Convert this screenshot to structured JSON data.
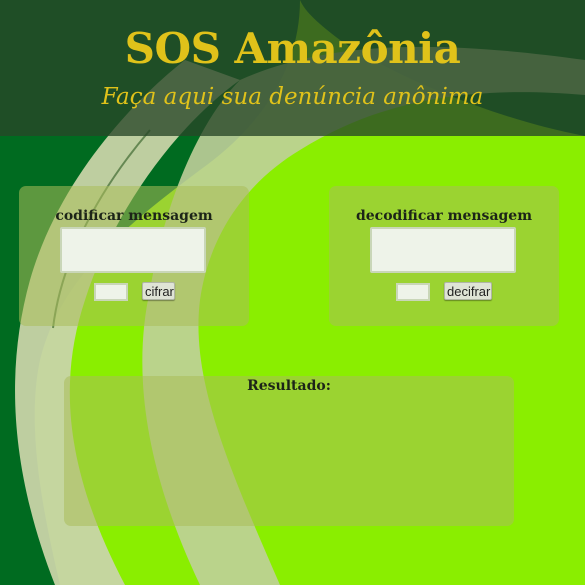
{
  "header": {
    "title": "SOS Amazônia",
    "subtitle": "Faça aqui sua denúncia anônima"
  },
  "encode": {
    "label": "codificar mensagem",
    "message_value": "",
    "key_value": "",
    "button_label": "cifrar"
  },
  "decode": {
    "label": "decodificar mensagem",
    "message_value": "",
    "key_value": "",
    "button_label": "decifrar"
  },
  "result": {
    "label": "Resultado:",
    "output": ""
  },
  "colors": {
    "background": "#8aee00",
    "dark_green": "#006b20",
    "header_overlay": "#284628",
    "title_gold": "#e0c21a",
    "panel": "#aabe5a"
  }
}
